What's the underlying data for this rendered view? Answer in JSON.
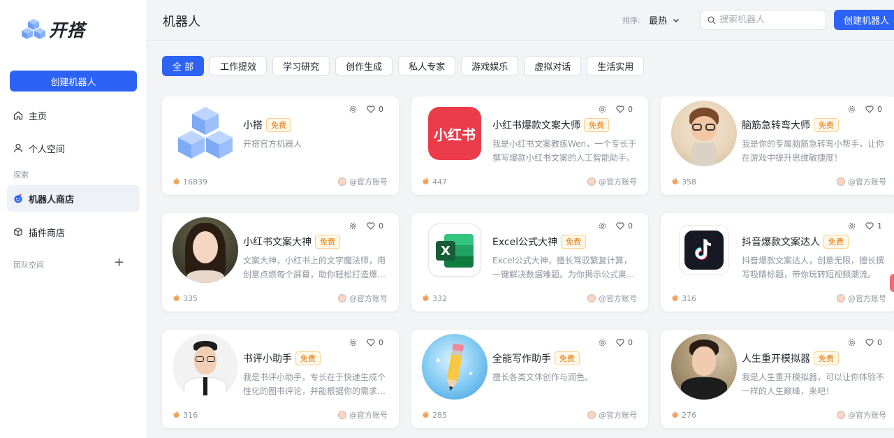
{
  "app": {
    "name": "开搭"
  },
  "sidebar": {
    "create_label": "创建机器人",
    "items": [
      {
        "label": "主页",
        "icon": "home-icon"
      },
      {
        "label": "个人空间",
        "icon": "user-icon"
      },
      {
        "label": "机器人商店",
        "icon": "bot-store-icon"
      },
      {
        "label": "插件商店",
        "icon": "plugin-icon"
      }
    ],
    "section_explore": "探索",
    "section_team": "团队空间"
  },
  "header": {
    "title": "机器人",
    "sort_label": "排序:",
    "sort_value": "最热",
    "search_placeholder": "搜索机器人",
    "create_label": "创建机器人"
  },
  "tabs": [
    {
      "label": "全 部",
      "active": true
    },
    {
      "label": "工作提效"
    },
    {
      "label": "学习研究"
    },
    {
      "label": "创作生成"
    },
    {
      "label": "私人专家"
    },
    {
      "label": "游戏娱乐"
    },
    {
      "label": "虚拟对话"
    },
    {
      "label": "生活实用"
    }
  ],
  "badge_label": "免费",
  "cards": [
    {
      "name": "小搭",
      "desc": "开搭官方机器人",
      "likes": "0",
      "uses": "16839",
      "author": "@官方账号",
      "avatar": "cube-logo"
    },
    {
      "name": "小红书爆款文案大师",
      "desc": "我是小红书文案教练Wen，一个专长于撰写爆款小红书文案的人工智能助手。",
      "likes": "0",
      "uses": "447",
      "author": "@官方账号",
      "avatar": "xiaohongshu-logo",
      "avatar_text": "小红书"
    },
    {
      "name": "脑筋急转弯大师",
      "desc": "我是你的专属脑筋急转弯小帮手，让你在游戏中提升思维敏捷度！",
      "likes": "0",
      "uses": "358",
      "author": "@官方账号",
      "avatar": "cartoon-boy-avatar"
    },
    {
      "name": "小红书文案大神",
      "desc": "文案大神，小红书上的文字魔法师，用创意点燃每个屏幕，助你轻松打造爆款。",
      "likes": "0",
      "uses": "335",
      "author": "@官方账号",
      "avatar": "woman-portrait"
    },
    {
      "name": "Excel公式大神",
      "desc": "Excel公式大神，擅长驾驭繁复计算，一键解决数据难题。为你揭示公式奥秘。",
      "likes": "0",
      "uses": "332",
      "author": "@官方账号",
      "avatar": "excel-logo",
      "avatar_text": "X"
    },
    {
      "name": "抖音爆款文案达人",
      "desc": "抖音爆款文案达人，创意无限，擅长撰写吸睛标题，带你玩转短视频潮流。",
      "likes": "1",
      "uses": "316",
      "author": "@官方账号",
      "avatar": "tiktok-logo"
    },
    {
      "name": "书评小助手",
      "desc": "我是书评小助手，专长在于快速生成个性化的图书评论，并能根据你的需求调整。",
      "likes": "0",
      "uses": "316",
      "author": "@官方账号",
      "avatar": "man-portrait"
    },
    {
      "name": "全能写作助手",
      "desc": "擅长各类文体创作与润色。",
      "likes": "0",
      "uses": "285",
      "author": "@官方账号",
      "avatar": "pencil-logo"
    },
    {
      "name": "人生重开模拟器",
      "desc": "我是人生重开模拟器，可以让你体验不一样的人生巅峰，来吧！",
      "likes": "0",
      "uses": "276",
      "author": "@官方账号",
      "avatar": "young-man-portrait"
    }
  ],
  "colors": {
    "primary": "#2d63f5",
    "badge": "#e3780c",
    "xiaohongshu": "#ec3b4a",
    "excel": "#1f7a47",
    "tiktok": "#161823"
  }
}
